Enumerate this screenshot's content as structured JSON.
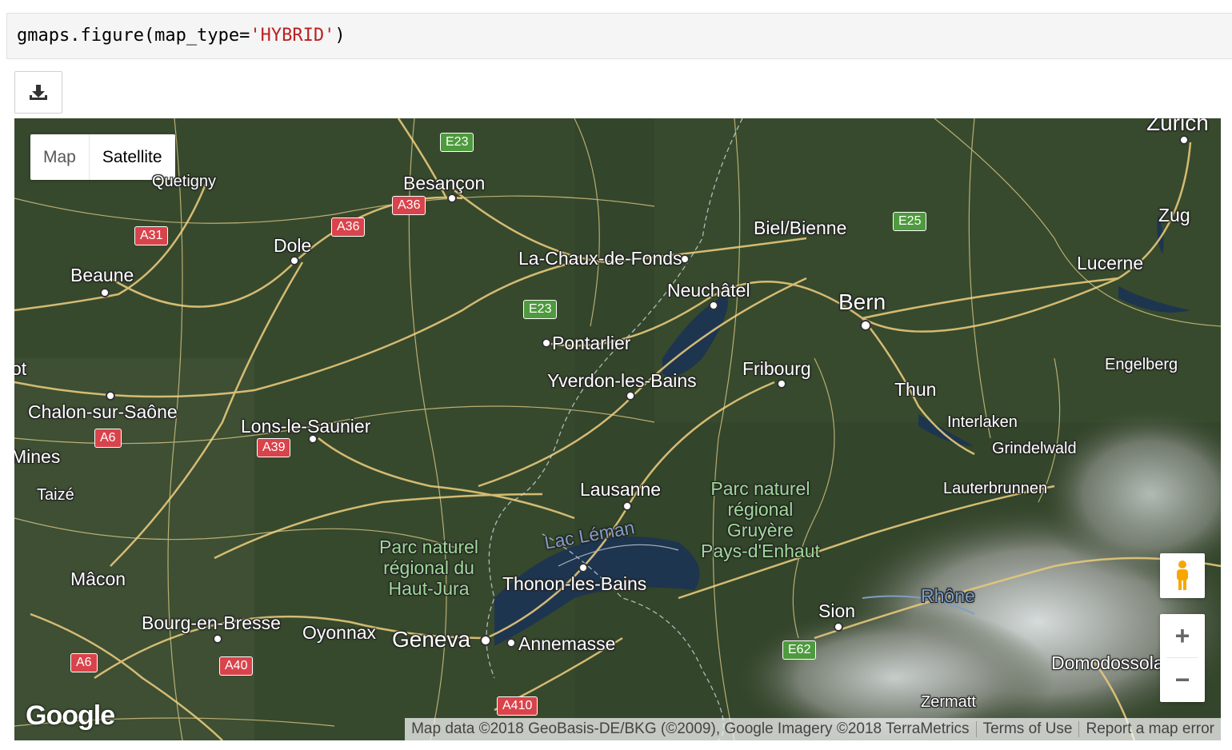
{
  "code": {
    "prefix": "gmaps.figure(map_type=",
    "string": "'HYBRID'",
    "suffix": ")"
  },
  "download_button": {
    "icon": "download-icon"
  },
  "map": {
    "map_type_options": {
      "map": "Map",
      "satellite": "Satellite"
    },
    "cities": [
      {
        "name": "Zurich",
        "cls": "big"
      },
      {
        "name": "Quetigny",
        "cls": "small"
      },
      {
        "name": "Besançon",
        "cls": ""
      },
      {
        "name": "Dole",
        "cls": ""
      },
      {
        "name": "Beaune",
        "cls": ""
      },
      {
        "name": "La-Chaux-de-Fonds",
        "cls": ""
      },
      {
        "name": "Biel/Bienne",
        "cls": ""
      },
      {
        "name": "Zug",
        "cls": ""
      },
      {
        "name": "Lucerne",
        "cls": ""
      },
      {
        "name": "Neuchâtel",
        "cls": ""
      },
      {
        "name": "Bern",
        "cls": "big"
      },
      {
        "name": "Pontarlier",
        "cls": ""
      },
      {
        "name": "Yverdon-les-Bains",
        "cls": ""
      },
      {
        "name": "Fribourg",
        "cls": ""
      },
      {
        "name": "Engelberg",
        "cls": "small"
      },
      {
        "name": "Thun",
        "cls": ""
      },
      {
        "name": "Chalon-sur-Saône",
        "cls": ""
      },
      {
        "name": "Lons-le-Saunier",
        "cls": ""
      },
      {
        "name": "Interlaken",
        "cls": "small"
      },
      {
        "name": "Grindelwald",
        "cls": "small"
      },
      {
        "name": "Mines",
        "cls": ""
      },
      {
        "name": "Taizé",
        "cls": "small"
      },
      {
        "name": "Lauterbrunnen",
        "cls": "small"
      },
      {
        "name": "Lausanne",
        "cls": ""
      },
      {
        "name": "Mâcon",
        "cls": ""
      },
      {
        "name": "Thonon-les-Bains",
        "cls": ""
      },
      {
        "name": "Bourg-en-Bresse",
        "cls": ""
      },
      {
        "name": "Oyonnax",
        "cls": ""
      },
      {
        "name": "Geneva",
        "cls": "big"
      },
      {
        "name": "Annemasse",
        "cls": ""
      },
      {
        "name": "Sion",
        "cls": ""
      },
      {
        "name": "Domodossola",
        "cls": ""
      },
      {
        "name": "Zermatt",
        "cls": "small"
      },
      {
        "name": "ot",
        "cls": ""
      }
    ],
    "parks": [
      "Parc naturel\nrégional\nGruyère\nPays-d'Enhaut",
      "Parc naturel\nrégional du\nHaut-Jura"
    ],
    "water": [
      "Lac Léman",
      "Rhône"
    ],
    "road_shields": [
      {
        "label": "E23",
        "color": "green"
      },
      {
        "label": "A36",
        "color": "red"
      },
      {
        "label": "A31",
        "color": "red"
      },
      {
        "label": "A36",
        "color": "red"
      },
      {
        "label": "E25",
        "color": "green"
      },
      {
        "label": "E23",
        "color": "green"
      },
      {
        "label": "A6",
        "color": "red"
      },
      {
        "label": "A39",
        "color": "red"
      },
      {
        "label": "A6",
        "color": "red"
      },
      {
        "label": "A40",
        "color": "red"
      },
      {
        "label": "E62",
        "color": "green"
      },
      {
        "label": "A410",
        "color": "red"
      }
    ],
    "logo": "Google",
    "attribution": {
      "data": "Map data ©2018 GeoBasis-DE/BKG (©2009), Google Imagery ©2018 TerraMetrics",
      "terms": "Terms of Use",
      "report": "Report a map error"
    },
    "zoom_in": "+",
    "zoom_out": "−"
  }
}
